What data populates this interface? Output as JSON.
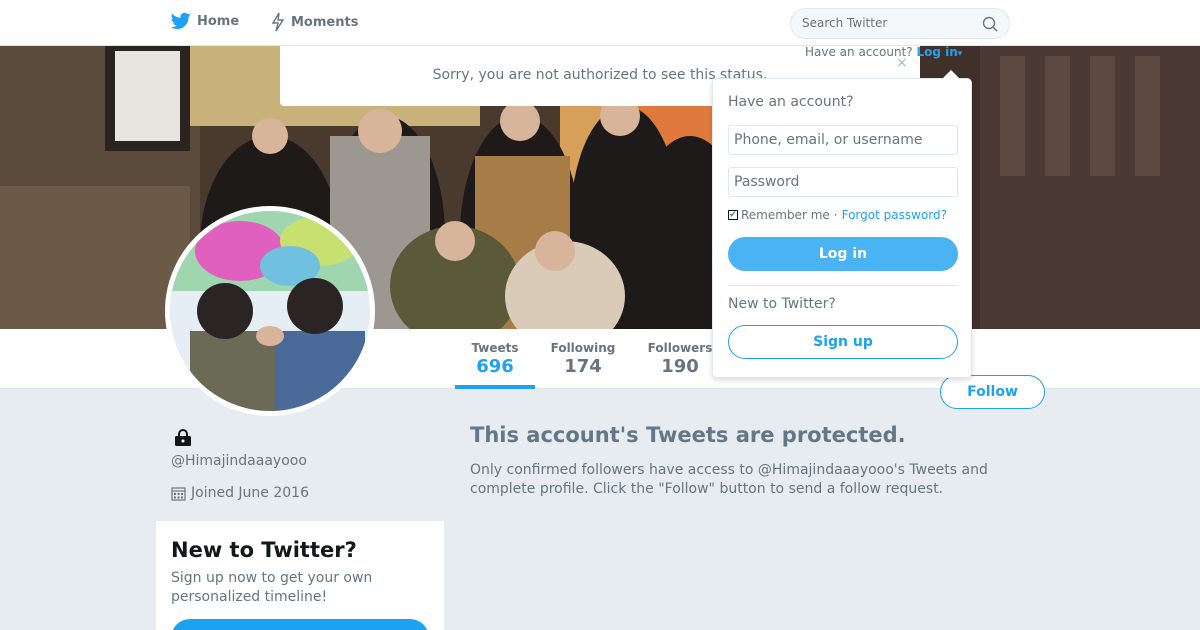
{
  "nav": {
    "home_label": "Home",
    "moments_label": "Moments",
    "search_placeholder": "Search Twitter",
    "have_account_text": "Have an account?",
    "login_link": "Log in"
  },
  "alert": {
    "message": "Sorry, you are not authorized to see this status.",
    "close_glyph": "×"
  },
  "profile": {
    "handle": "@Himajindaaayooo",
    "joined": "Joined June 2016",
    "stats": [
      {
        "label": "Tweets",
        "value": "696"
      },
      {
        "label": "Following",
        "value": "174"
      },
      {
        "label": "Followers",
        "value": "190"
      }
    ],
    "follow_label": "Follow"
  },
  "protected": {
    "title": "This account's Tweets are protected.",
    "description": "Only confirmed followers have access to @Himajindaaayooo's Tweets and complete profile. Click the \"Follow\" button to send a follow request."
  },
  "new_card": {
    "title": "New to Twitter?",
    "description": "Sign up now to get your own personalized timeline!"
  },
  "login_dropdown": {
    "heading": "Have an account?",
    "username_placeholder": "Phone, email, or username",
    "password_placeholder": "Password",
    "remember_label": "Remember me",
    "separator": "·",
    "forgot_label": "Forgot password?",
    "login_button": "Log in",
    "new_heading": "New to Twitter?",
    "signup_button": "Sign up"
  },
  "colors": {
    "accent": "#1da1f2",
    "background": "#e6ecf0",
    "muted_text": "#66757f"
  }
}
